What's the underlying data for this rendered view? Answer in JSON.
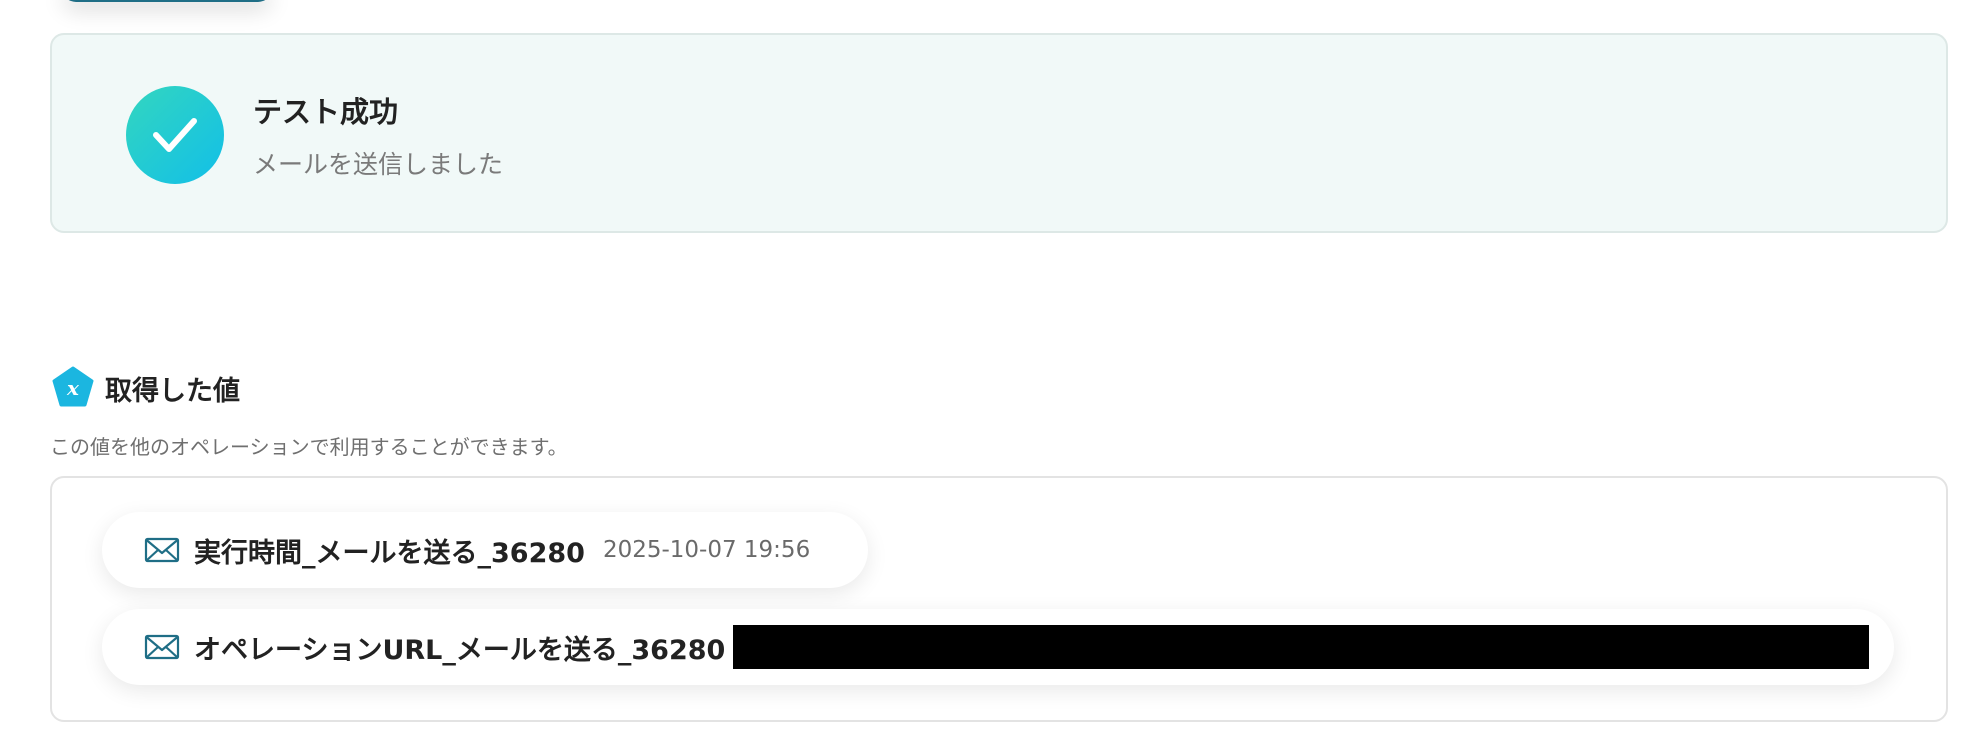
{
  "success": {
    "title": "テスト成功",
    "subtitle": "メールを送信しました",
    "icon": "check-icon"
  },
  "fetched": {
    "icon": "variable-x-icon",
    "title": "取得した値",
    "description": "この値を他のオペレーションで利用することができます。",
    "items": [
      {
        "icon": "mail-icon",
        "label": "実行時間_メールを送る_36280",
        "value": "2025-10-07 19:56",
        "redacted": false
      },
      {
        "icon": "mail-icon",
        "label": "オペレーションURL_メールを送る_36280",
        "value": "",
        "redacted": true
      }
    ]
  },
  "colors": {
    "success_bg": "#f1f9f8",
    "check_gradient_start": "#33d6bf",
    "check_gradient_end": "#12bfe8",
    "accent_blue": "#1bb6e0",
    "mail_icon": "#1f6e86"
  }
}
